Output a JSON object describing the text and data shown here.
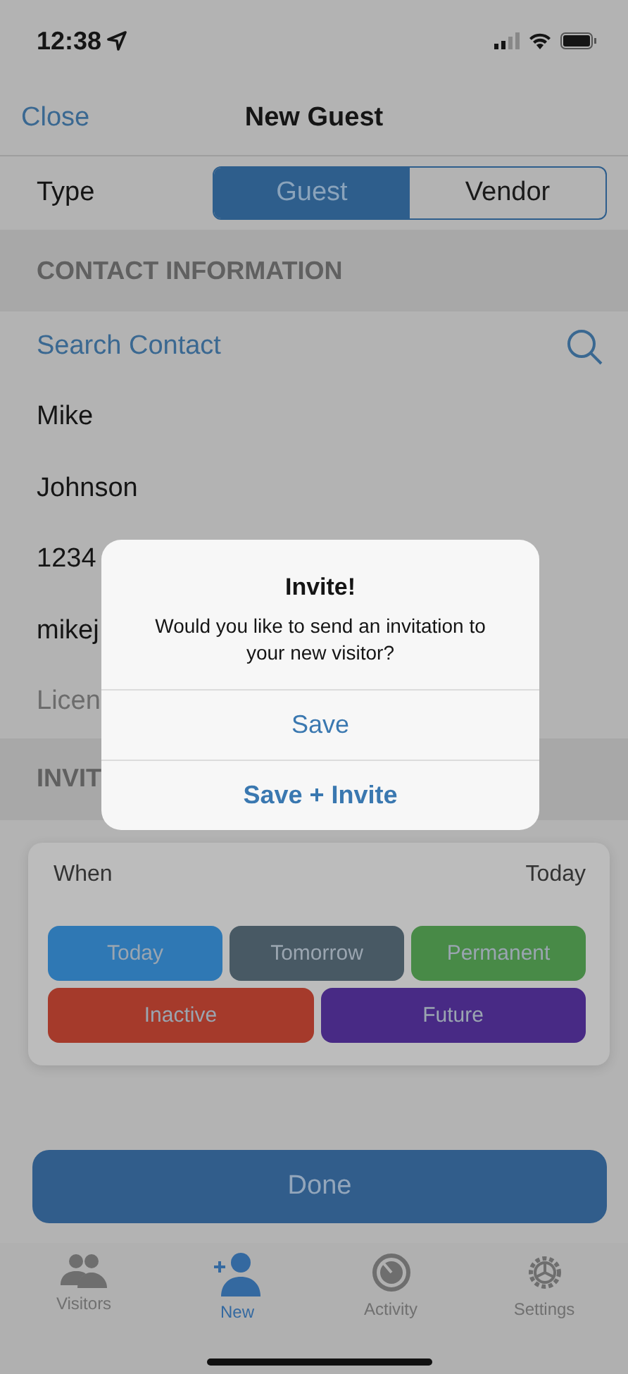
{
  "status_bar": {
    "time": "12:38"
  },
  "nav": {
    "close": "Close",
    "title": "New Guest"
  },
  "type_row": {
    "label": "Type",
    "segments": [
      {
        "label": "Guest",
        "selected": true
      },
      {
        "label": "Vendor",
        "selected": false
      }
    ]
  },
  "contact_section": {
    "header": "CONTACT INFORMATION",
    "search": "Search Contact",
    "fields": [
      {
        "value": "Mike"
      },
      {
        "value": "Johnson"
      },
      {
        "value": "1234"
      },
      {
        "value": "mikej"
      },
      {
        "placeholder": "Licen"
      }
    ]
  },
  "invite_section": {
    "header": "INVIT"
  },
  "when_card": {
    "label": "When",
    "value": "Today",
    "buttons": [
      {
        "label": "Today",
        "color": "#2f78b4"
      },
      {
        "label": "Tomorrow",
        "color": "#485964"
      },
      {
        "label": "Permanent",
        "color": "#488a47"
      },
      {
        "label": "Inactive",
        "color": "#a53a2b"
      },
      {
        "label": "Future",
        "color": "#482a85"
      }
    ]
  },
  "done_button": "Done",
  "tabs": [
    {
      "label": "Visitors",
      "selected": false
    },
    {
      "label": "New",
      "selected": true
    },
    {
      "label": "Activity",
      "selected": false
    },
    {
      "label": "Settings",
      "selected": false
    }
  ],
  "dialog": {
    "title": "Invite!",
    "message": "Would you like to send an invitation to your new visitor?",
    "actions": [
      {
        "label": "Save",
        "bold": false
      },
      {
        "label": "Save + Invite",
        "bold": true
      }
    ]
  }
}
